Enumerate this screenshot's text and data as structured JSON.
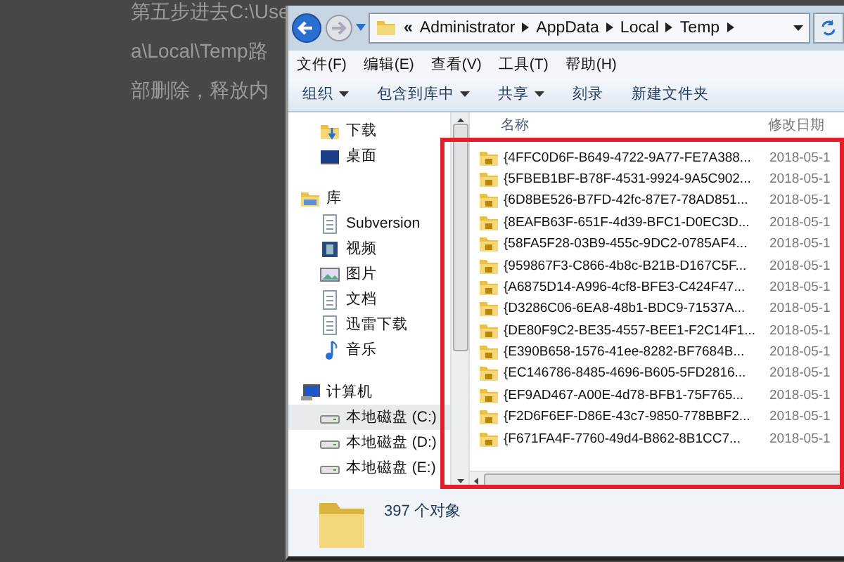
{
  "article": {
    "lines": [
      "第五步进去C:\\Use",
      "a\\Local\\Temp路",
      "部删除，释放内"
    ]
  },
  "address_bar": {
    "overflow": "«",
    "crumbs": [
      "Administrator",
      "AppData",
      "Local",
      "Temp"
    ]
  },
  "menu": [
    "文件(F)",
    "编辑(E)",
    "查看(V)",
    "工具(T)",
    "帮助(H)"
  ],
  "toolbar": [
    {
      "label": "组织",
      "dropdown": true
    },
    {
      "label": "包含到库中",
      "dropdown": true
    },
    {
      "label": "共享",
      "dropdown": true
    },
    {
      "label": "刻录",
      "dropdown": false
    },
    {
      "label": "新建文件夹",
      "dropdown": false
    }
  ],
  "nav": {
    "sections": [
      {
        "children": [
          {
            "label": "下载",
            "kind": "download",
            "selected": false
          },
          {
            "label": "桌面",
            "kind": "desktop",
            "selected": false
          }
        ]
      },
      {
        "label": "库",
        "kind": "library",
        "children": [
          {
            "label": "Subversion",
            "kind": "doc",
            "selected": false
          },
          {
            "label": "视频",
            "kind": "video",
            "selected": false
          },
          {
            "label": "图片",
            "kind": "picture",
            "selected": false
          },
          {
            "label": "文档",
            "kind": "doc",
            "selected": false
          },
          {
            "label": "迅雷下载",
            "kind": "doc",
            "selected": false
          },
          {
            "label": "音乐",
            "kind": "music",
            "selected": false
          }
        ]
      },
      {
        "label": "计算机",
        "kind": "computer",
        "children": [
          {
            "label": "本地磁盘 (C:)",
            "kind": "drive",
            "selected": true
          },
          {
            "label": "本地磁盘 (D:)",
            "kind": "drive",
            "selected": false
          },
          {
            "label": "本地磁盘 (E:)",
            "kind": "drive",
            "selected": false
          }
        ]
      }
    ]
  },
  "table": {
    "columns": [
      "名称",
      "修改日期"
    ],
    "rows": [
      [
        "{4FFC0D6F-B649-4722-9A77-FE7A388...",
        "2018-05-1"
      ],
      [
        "{5FBEB1BF-B78F-4531-9924-9A5C902...",
        "2018-05-1"
      ],
      [
        "{6D8BE526-B7FD-42fc-87E7-78AD851...",
        "2018-05-1"
      ],
      [
        "{8EAFB63F-651F-4d39-BFC1-D0EC3D...",
        "2018-05-1"
      ],
      [
        "{58FA5F28-03B9-455c-9DC2-0785AF4...",
        "2018-05-1"
      ],
      [
        "{959867F3-C866-4b8c-B21B-D167C5F...",
        "2018-05-1"
      ],
      [
        "{A6875D14-A996-4cf8-BFE3-C424F47...",
        "2018-05-1"
      ],
      [
        "{D3286C06-6EA8-48b1-BDC9-71537A...",
        "2018-05-1"
      ],
      [
        "{DE80F9C2-BE35-4557-BEE1-F2C14F1...",
        "2018-05-1"
      ],
      [
        "{E390B658-1576-41ee-8282-BF7684B...",
        "2018-05-1"
      ],
      [
        "{EC146786-8485-4696-B605-5FD2816...",
        "2018-05-1"
      ],
      [
        "{EF9AD467-A00E-4d78-BFB1-75F765...",
        "2018-05-1"
      ],
      [
        "{F2D6F6EF-D86E-43c7-9850-778BBF2...",
        "2018-05-1"
      ],
      [
        "{F671FA4F-7760-49d4-B862-8B1CC7...",
        "2018-05-1"
      ]
    ]
  },
  "status_bar": {
    "count": "397 个对象"
  }
}
